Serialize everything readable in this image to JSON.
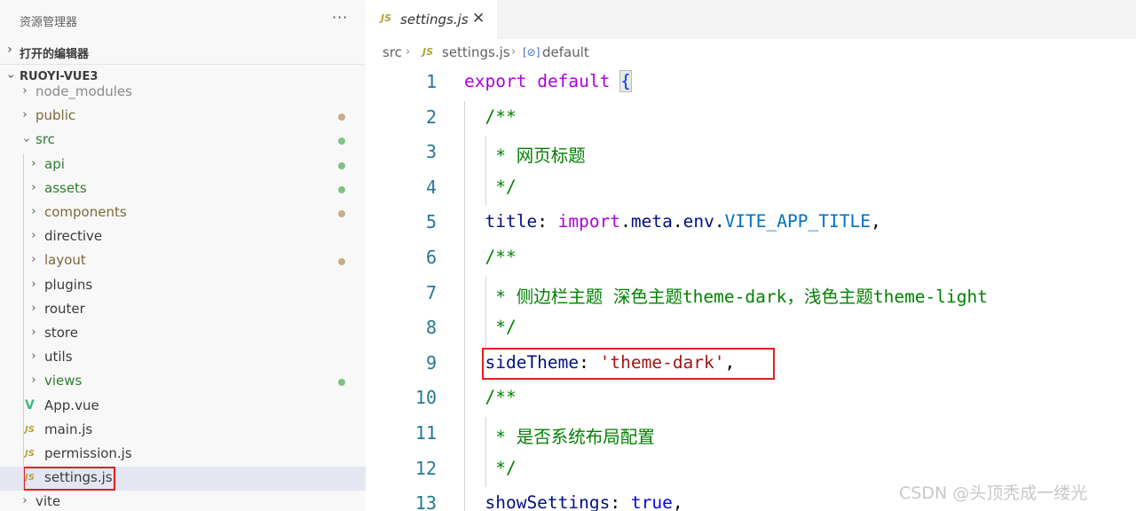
{
  "explorer": {
    "title": "资源管理器",
    "more": "···",
    "open_editors_label": "打开的编辑器",
    "project_label": "RUOYI-VUE3",
    "tree": [
      {
        "name": "node_modules",
        "type": "folder",
        "color": "#8a8a8a",
        "status": "",
        "level": 1
      },
      {
        "name": "public",
        "type": "folder",
        "color": "#7a6a3a",
        "status": "#c8ad87",
        "level": 1
      },
      {
        "name": "src",
        "type": "folder-open",
        "color": "#2e7d32",
        "status": "#7ec285",
        "level": 1
      },
      {
        "name": "api",
        "type": "folder",
        "color": "#2e7d32",
        "status": "#7ec285",
        "level": 2
      },
      {
        "name": "assets",
        "type": "folder",
        "color": "#2e7d32",
        "status": "#7ec285",
        "level": 2
      },
      {
        "name": "components",
        "type": "folder",
        "color": "#7a6a3a",
        "status": "#c8ad87",
        "level": 2
      },
      {
        "name": "directive",
        "type": "folder",
        "color": "#3b3b3b",
        "status": "",
        "level": 2
      },
      {
        "name": "layout",
        "type": "folder",
        "color": "#7a6a3a",
        "status": "#c8ad87",
        "level": 2
      },
      {
        "name": "plugins",
        "type": "folder",
        "color": "#3b3b3b",
        "status": "",
        "level": 2
      },
      {
        "name": "router",
        "type": "folder",
        "color": "#3b3b3b",
        "status": "",
        "level": 2
      },
      {
        "name": "store",
        "type": "folder",
        "color": "#3b3b3b",
        "status": "",
        "level": 2
      },
      {
        "name": "utils",
        "type": "folder",
        "color": "#3b3b3b",
        "status": "",
        "level": 2
      },
      {
        "name": "views",
        "type": "folder",
        "color": "#2e7d32",
        "status": "#7ec285",
        "level": 2
      },
      {
        "name": "App.vue",
        "type": "vue",
        "color": "#3b3b3b",
        "status": "",
        "level": 2
      },
      {
        "name": "main.js",
        "type": "js",
        "color": "#3b3b3b",
        "status": "",
        "level": 2
      },
      {
        "name": "permission.js",
        "type": "js",
        "color": "#3b3b3b",
        "status": "",
        "level": 2
      },
      {
        "name": "settings.js",
        "type": "js",
        "color": "#3b3b3b",
        "status": "",
        "level": 2,
        "selected": true
      },
      {
        "name": "vite",
        "type": "folder",
        "color": "#3b3b3b",
        "status": "",
        "level": 1
      }
    ]
  },
  "editor": {
    "tab": {
      "icon": "JS",
      "name": "settings.js",
      "close": "✕"
    },
    "breadcrumb": {
      "src": "src",
      "file": "settings.js",
      "symbol_icon": "[⊘]",
      "symbol": "default"
    },
    "lines": [
      {
        "n": "1",
        "tokens": [
          [
            "kw",
            "export"
          ],
          [
            "",
            " "
          ],
          [
            "kw",
            "default"
          ],
          [
            "",
            " "
          ],
          [
            "brace",
            "{"
          ]
        ]
      },
      {
        "n": "2",
        "tokens": [
          [
            "",
            "  "
          ],
          [
            "cm",
            "/**"
          ]
        ]
      },
      {
        "n": "3",
        "tokens": [
          [
            "",
            "  "
          ],
          [
            "cm",
            " * 网页标题"
          ]
        ]
      },
      {
        "n": "4",
        "tokens": [
          [
            "",
            "  "
          ],
          [
            "cm",
            " */"
          ]
        ]
      },
      {
        "n": "5",
        "tokens": [
          [
            "",
            "  "
          ],
          [
            "prop",
            "title"
          ],
          [
            "",
            ": "
          ],
          [
            "kw",
            "import"
          ],
          [
            "",
            "."
          ],
          [
            "prop",
            "meta"
          ],
          [
            "",
            "."
          ],
          [
            "prop",
            "env"
          ],
          [
            "",
            "."
          ],
          [
            "const",
            "VITE_APP_TITLE"
          ],
          [
            "",
            ","
          ]
        ]
      },
      {
        "n": "6",
        "tokens": [
          [
            "",
            "  "
          ],
          [
            "cm",
            "/**"
          ]
        ]
      },
      {
        "n": "7",
        "tokens": [
          [
            "",
            "  "
          ],
          [
            "cm",
            " * 侧边栏主题 深色主题theme-dark，浅色主题theme-light"
          ]
        ]
      },
      {
        "n": "8",
        "tokens": [
          [
            "",
            "  "
          ],
          [
            "cm",
            " */"
          ]
        ]
      },
      {
        "n": "9",
        "tokens": [
          [
            "",
            "  "
          ],
          [
            "prop",
            "sideTheme"
          ],
          [
            "",
            ": "
          ],
          [
            "str",
            "'theme-dark'"
          ],
          [
            "",
            ","
          ]
        ]
      },
      {
        "n": "10",
        "tokens": [
          [
            "",
            "  "
          ],
          [
            "cm",
            "/**"
          ]
        ]
      },
      {
        "n": "11",
        "tokens": [
          [
            "",
            "  "
          ],
          [
            "cm",
            " * 是否系统布局配置"
          ]
        ]
      },
      {
        "n": "12",
        "tokens": [
          [
            "",
            "  "
          ],
          [
            "cm",
            " */"
          ]
        ]
      },
      {
        "n": "13",
        "tokens": [
          [
            "",
            "  "
          ],
          [
            "prop",
            "showSettings"
          ],
          [
            "",
            ": "
          ],
          [
            "kw2",
            "true"
          ],
          [
            "",
            ","
          ]
        ]
      }
    ]
  },
  "watermark": "CSDN @头顶秃成一缕光"
}
